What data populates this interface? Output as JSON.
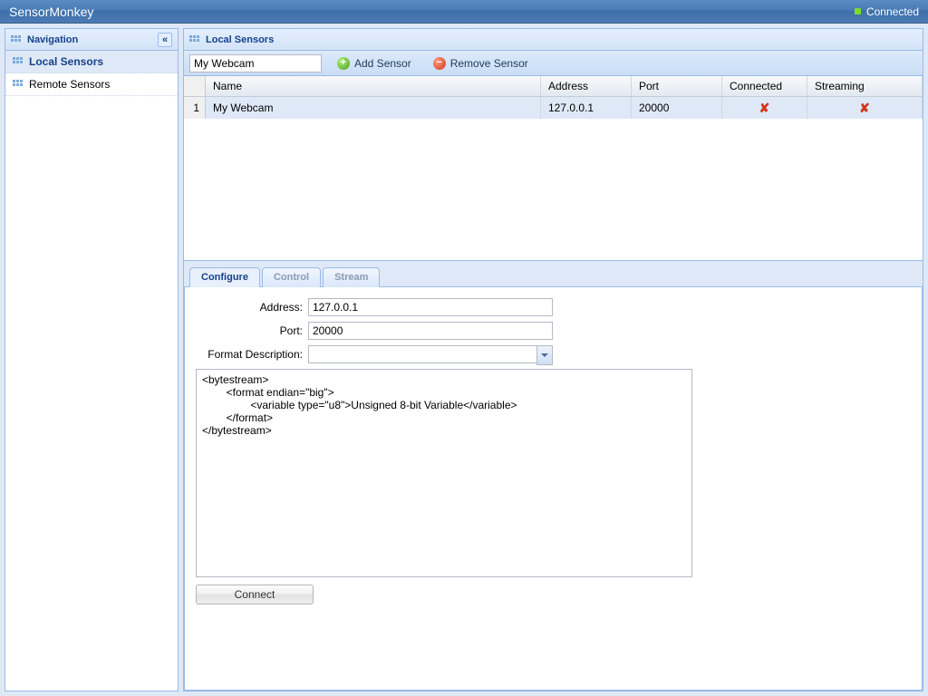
{
  "app_title": "SensorMonkey",
  "status_text": "Connected",
  "nav": {
    "title": "Navigation",
    "items": [
      "Local Sensors",
      "Remote Sensors"
    ],
    "selected_index": 0
  },
  "main_panel_title": "Local Sensors",
  "toolbar": {
    "sensor_name_value": "My Webcam",
    "add_label": "Add Sensor",
    "remove_label": "Remove Sensor"
  },
  "grid": {
    "columns": {
      "name": "Name",
      "address": "Address",
      "port": "Port",
      "connected": "Connected",
      "streaming": "Streaming"
    },
    "rows": [
      {
        "index": "1",
        "name": "My Webcam",
        "address": "127.0.0.1",
        "port": "20000",
        "connected": false,
        "streaming": false
      }
    ]
  },
  "tabs": {
    "configure": "Configure",
    "control": "Control",
    "stream": "Stream"
  },
  "form": {
    "address_label": "Address:",
    "address_value": "127.0.0.1",
    "port_label": "Port:",
    "port_value": "20000",
    "format_label": "Format Description:",
    "format_value": "",
    "bytestream": "<bytestream>\n        <format endian=\"big\">\n                <variable type=\"u8\">Unsigned 8-bit Variable</variable>\n        </format>\n</bytestream>",
    "connect_label": "Connect"
  }
}
